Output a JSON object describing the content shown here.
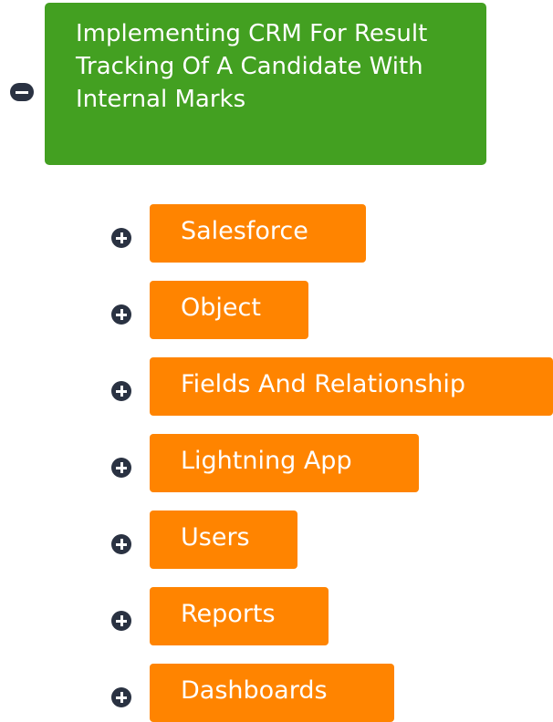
{
  "root": {
    "title": "Implementing CRM For Result Tracking Of A Candidate With Internal Marks",
    "toggle_icon": "minus-circle-icon",
    "color": "#43a021"
  },
  "children": [
    {
      "label": "Salesforce",
      "toggle_icon": "plus-circle-icon"
    },
    {
      "label": "Object",
      "toggle_icon": "plus-circle-icon"
    },
    {
      "label": "Fields And Relationship",
      "toggle_icon": "plus-circle-icon"
    },
    {
      "label": "Lightning App",
      "toggle_icon": "plus-circle-icon"
    },
    {
      "label": "Users",
      "toggle_icon": "plus-circle-icon"
    },
    {
      "label": "Reports",
      "toggle_icon": "plus-circle-icon"
    },
    {
      "label": "Dashboards",
      "toggle_icon": "plus-circle-icon"
    }
  ],
  "colors": {
    "child_node": "#ff8400",
    "toggle": "#2a3242",
    "text": "#ffffff"
  }
}
